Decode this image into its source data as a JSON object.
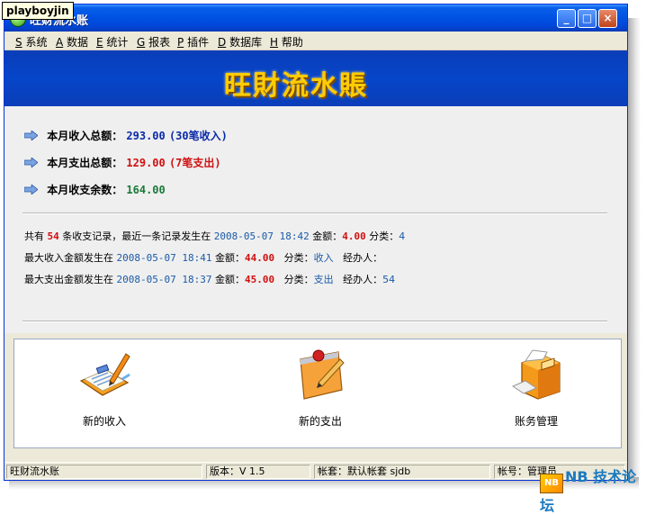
{
  "watermark": "playboyjin",
  "window": {
    "title": "旺财流水账"
  },
  "titlebar_buttons": {
    "minimize": "_",
    "maximize": "□",
    "close": "×"
  },
  "menu": [
    {
      "key": "S",
      "label": "系统"
    },
    {
      "key": "A",
      "label": "数据"
    },
    {
      "key": "E",
      "label": "统计"
    },
    {
      "key": "G",
      "label": "报表"
    },
    {
      "key": "P",
      "label": "插件"
    },
    {
      "key": "D",
      "label": "数据库"
    },
    {
      "key": "H",
      "label": "帮助"
    }
  ],
  "banner": {
    "title": "旺財流水賬"
  },
  "summary": {
    "income": {
      "label": "本月收入总额：",
      "value": "293.00",
      "detail": "(30笔收入)"
    },
    "expense": {
      "label": "本月支出总额：",
      "value": "129.00",
      "detail": "(7笔支出)"
    },
    "balance": {
      "label": "本月收支余数：",
      "value": "164.00"
    }
  },
  "info": {
    "line1": {
      "prefix": "共有",
      "count": "54",
      "mid": "条收支记录，最近一条记录发生在",
      "time": "2008-05-07 18:42",
      "amount_label": "金额：",
      "amount": "4.00",
      "cat_label": "分类：",
      "category": "4"
    },
    "line2": {
      "prefix": "最大收入金额发生在",
      "time": "2008-05-07 18:41",
      "amount_label": "金额：",
      "amount": "44.00",
      "cat_label": "分类：",
      "category": "收入",
      "handler_label": "经办人：",
      "handler": ""
    },
    "line3": {
      "prefix": "最大支出金额发生在",
      "time": "2008-05-07 18:37",
      "amount_label": "金额：",
      "amount": "45.00",
      "cat_label": "分类：",
      "category": "支出",
      "handler_label": "经办人：",
      "handler": "54"
    }
  },
  "actions": [
    {
      "label": "新的收入",
      "icon": "clipboard-pencil-icon"
    },
    {
      "label": "新的支出",
      "icon": "note-pencil-icon"
    },
    {
      "label": "账务管理",
      "icon": "file-cabinet-icon"
    }
  ],
  "status": {
    "app": "旺财流水账",
    "version": "版本：V 1.5",
    "account_set": "帐套：默认帐套 sjdb",
    "account_no": "帐号：管理员"
  },
  "brand": {
    "text": "NB 技术论坛",
    "box": "NB"
  },
  "colors": {
    "titlebar": "#0055e5",
    "banner": "#0a3db8",
    "banner_text": "#ffcc00",
    "income": "#0a2aa8",
    "expense": "#d01010",
    "balance": "#1a7a3a"
  }
}
